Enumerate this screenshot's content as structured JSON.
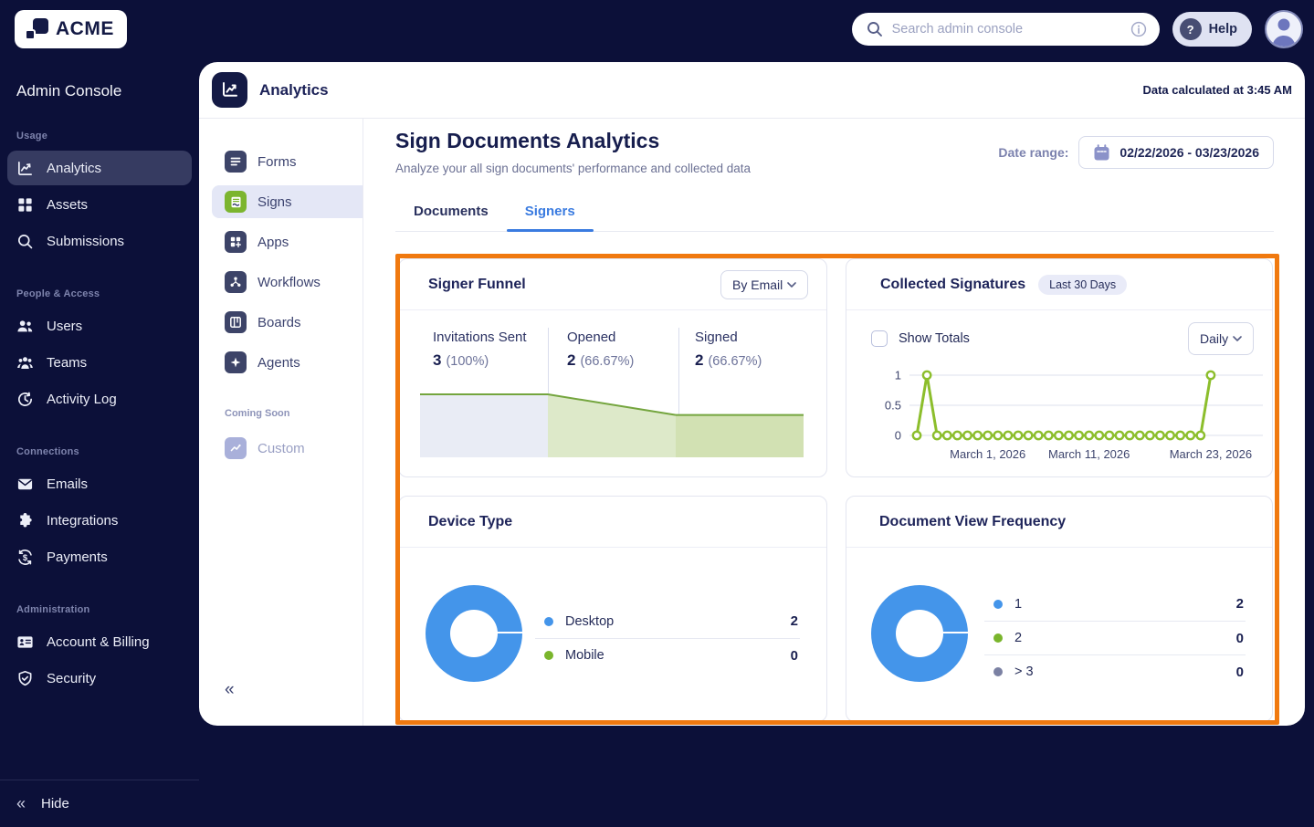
{
  "topbar": {
    "brand": "ACME",
    "search_placeholder": "Search admin console",
    "help_label": "Help"
  },
  "sidebar": {
    "title": "Admin Console",
    "hide_label": "Hide",
    "sections": [
      {
        "label": "Usage",
        "items": [
          {
            "label": "Analytics",
            "icon": "analytics-icon",
            "active": true
          },
          {
            "label": "Assets",
            "icon": "assets-icon"
          },
          {
            "label": "Submissions",
            "icon": "submissions-icon"
          }
        ]
      },
      {
        "label": "People & Access",
        "items": [
          {
            "label": "Users",
            "icon": "users-icon"
          },
          {
            "label": "Teams",
            "icon": "teams-icon"
          },
          {
            "label": "Activity Log",
            "icon": "activity-log-icon"
          }
        ]
      },
      {
        "label": "Connections",
        "items": [
          {
            "label": "Emails",
            "icon": "emails-icon"
          },
          {
            "label": "Integrations",
            "icon": "integrations-icon"
          },
          {
            "label": "Payments",
            "icon": "payments-icon"
          }
        ]
      },
      {
        "label": "Administration",
        "items": [
          {
            "label": "Account & Billing",
            "icon": "account-billing-icon"
          },
          {
            "label": "Security",
            "icon": "security-icon"
          }
        ]
      }
    ]
  },
  "panel": {
    "header": {
      "title": "Analytics",
      "status": "Data calculated at 3:45 AM"
    },
    "nav": {
      "items": [
        {
          "label": "Forms",
          "icon": "forms-icon"
        },
        {
          "label": "Signs",
          "icon": "signs-icon",
          "active": true
        },
        {
          "label": "Apps",
          "icon": "apps-icon"
        },
        {
          "label": "Workflows",
          "icon": "workflows-icon"
        },
        {
          "label": "Boards",
          "icon": "boards-icon"
        },
        {
          "label": "Agents",
          "icon": "agents-icon"
        }
      ],
      "coming_soon_label": "Coming Soon",
      "coming_soon_item": {
        "label": "Custom",
        "icon": "custom-icon"
      }
    },
    "content": {
      "title": "Sign Documents Analytics",
      "subtitle": "Analyze your all sign documents' performance and collected data",
      "date_range_label": "Date range:",
      "date_range_value": "02/22/2026 - 03/23/2026",
      "tabs": [
        {
          "label": "Documents"
        },
        {
          "label": "Signers",
          "active": true
        }
      ]
    }
  },
  "cards": {
    "signer_funnel": {
      "title": "Signer Funnel",
      "dropdown_value": "By Email",
      "stages": [
        {
          "label": "Invitations Sent",
          "value": "3",
          "pct": "(100%)"
        },
        {
          "label": "Opened",
          "value": "2",
          "pct": "(66.67%)"
        },
        {
          "label": "Signed",
          "value": "2",
          "pct": "(66.67%)"
        }
      ]
    },
    "collected_signatures": {
      "title": "Collected Signatures",
      "badge": "Last 30 Days",
      "checkbox_label": "Show Totals",
      "checkbox_checked": false,
      "dropdown_value": "Daily"
    },
    "device_type": {
      "title": "Device Type",
      "legend": [
        {
          "label": "Desktop",
          "value": "2",
          "color": "#4495ea"
        },
        {
          "label": "Mobile",
          "value": "0",
          "color": "#7ab52c"
        }
      ]
    },
    "document_view_frequency": {
      "title": "Document View Frequency",
      "legend": [
        {
          "label": "1",
          "value": "2",
          "color": "#4495ea"
        },
        {
          "label": "2",
          "value": "0",
          "color": "#7ab52c"
        },
        {
          "label": "> 3",
          "value": "0",
          "color": "#7b81a3"
        }
      ]
    }
  },
  "colors": {
    "navy": "#0c1039",
    "accent_blue": "#3a7be0",
    "highlight_orange": "#f0790f",
    "donut_blue": "#4495ea",
    "green": "#7ab52c"
  },
  "chart_data": {
    "signer_funnel": {
      "type": "area",
      "stages": [
        "Invitations Sent",
        "Opened",
        "Signed"
      ],
      "values": [
        3,
        2,
        2
      ],
      "percents": [
        100,
        66.67,
        66.67
      ],
      "segment_fills": [
        "#e9ecf5",
        "#dde9c9",
        "#d2e1b3"
      ],
      "line_color": "#74a53e"
    },
    "collected_signatures": {
      "type": "line",
      "title": "Collected Signatures",
      "period": "Last 30 Days",
      "granularity": "Daily",
      "date_range": "02/22/2026 - 03/23/2026",
      "yticks": [
        1,
        0.5,
        0
      ],
      "ylim": [
        0,
        1
      ],
      "values": [
        0,
        1,
        0,
        0,
        0,
        0,
        0,
        0,
        0,
        0,
        0,
        0,
        0,
        0,
        0,
        0,
        0,
        0,
        0,
        0,
        0,
        0,
        0,
        0,
        0,
        0,
        0,
        0,
        0,
        1
      ],
      "x_tick_labels": [
        "March 1, 2026",
        "March 11, 2026",
        "March 23, 2026"
      ],
      "x_tick_indices": [
        7,
        17,
        29
      ],
      "color": "#8cbe2c"
    },
    "device_type": {
      "type": "pie",
      "labels": [
        "Desktop",
        "Mobile"
      ],
      "values": [
        2,
        0
      ],
      "colors": [
        "#4495ea",
        "#7ab52c"
      ]
    },
    "document_view_frequency": {
      "type": "pie",
      "labels": [
        "1",
        "2",
        "> 3"
      ],
      "values": [
        2,
        0,
        0
      ],
      "colors": [
        "#4495ea",
        "#7ab52c",
        "#7b81a3"
      ]
    }
  }
}
